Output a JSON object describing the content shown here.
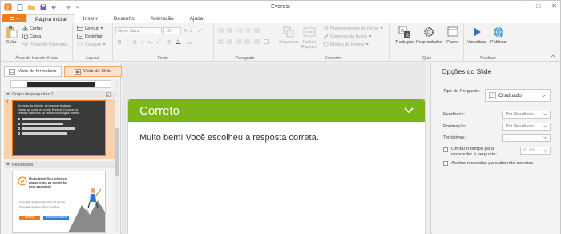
{
  "window": {
    "title": "Everest"
  },
  "tabs": [
    "Página Inicial",
    "Inserir",
    "Desenho",
    "Animação",
    "Ajuda"
  ],
  "ribbon": {
    "clipboard": {
      "paste": "Colar",
      "cut": "Cortar",
      "copy": "Cópia",
      "format_painter": "Pincel de Formatos",
      "label": "Área de transferência"
    },
    "layout": {
      "layout": "Layout",
      "reset": "Redefinir",
      "columns": "Colunas",
      "label": "Layout"
    },
    "font": {
      "font_name": "Open Sans",
      "font_size": "15",
      "label": "Fonte"
    },
    "paragraph": {
      "label": "Paragrafo"
    },
    "drawing": {
      "arrange": "Organizar",
      "quick_styles": "Estilos Rápidos",
      "fill": "Preenchimento de forma",
      "outline": "Contorno da forma",
      "effects": "Efeitos de Forma",
      "label": "Desenho"
    },
    "quiz": {
      "translation": "Tradução",
      "properties": "Propriedades",
      "player": "Player",
      "label": "Quiz"
    },
    "publish": {
      "preview": "Visualizar",
      "publish": "Publicar",
      "label": "Publicar"
    }
  },
  "left_panel": {
    "form_view": "Vista de formulário",
    "slide_view": "Vista de Slide",
    "group1": {
      "name": "Grupo de perguntas 1",
      "count": "1"
    },
    "slide1": {
      "number": "1.",
      "text": "Ao longo da história, as pessoas testaram chegar ao cume do monte Everest. Coloque os eventos históricos na ordem cronológica correta."
    },
    "group2": {
      "name": "Resultados"
    },
    "slide2": {
      "heading": "Muito bem! Seu primeiro passo rumo ao monte foi bem-sucedido!",
      "line1": "Pontuação da aprovação: 60% (75 pontos)",
      "line2": "Pontuação do aluno: 60% (75 pontos)",
      "btn1": "REVISAR",
      "btn2": "TENTAR NOVAMENTE"
    }
  },
  "canvas": {
    "feedback_title": "Correto",
    "feedback_text": "Muito bem! Você escolheu a resposta correta.",
    "accent": "#7cb518"
  },
  "right_panel": {
    "title": "Opções do Slide",
    "question_type_label": "Tipo de Pergunta:",
    "question_type": "Graduado",
    "feedback_label": "Feedback:",
    "feedback_value": "Por Resultado",
    "score_label": "Pontuação:",
    "score_value": "Por Resultado",
    "attempts_label": "Tentativas:",
    "attempts_value": "1",
    "time_limit_label": "Limitar o tempo para responder à pergunta:",
    "time_value": "01:00",
    "partial_label": "Aceitar respostas parcialmente corretas"
  },
  "colors": {
    "accent_orange": "#f07b1a",
    "selection": "#fbd2ad"
  }
}
